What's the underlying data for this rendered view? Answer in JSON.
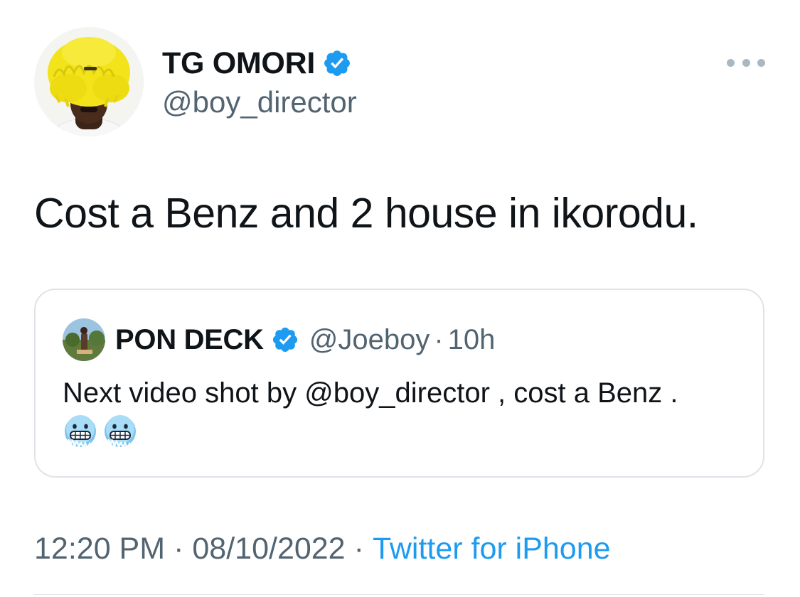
{
  "tweet": {
    "author": {
      "display_name": "TG OMORI",
      "handle": "@boy_director",
      "verified_icon": "verified-badge-icon"
    },
    "more_icon": "more-horizontal-icon",
    "text": "Cost a Benz and 2 house in ikorodu.",
    "quoted_tweet": {
      "display_name": "PON DECK",
      "handle": "@Joeboy",
      "separator": "·",
      "time": "10h",
      "text_before_emoji": "Next video shot by @boy_director , cost a Benz . ",
      "emojis": [
        "cold-face-emoji",
        "cold-face-emoji"
      ]
    },
    "meta": {
      "time": "12:20 PM",
      "dot": "·",
      "date": "08/10/2022",
      "source": "Twitter for iPhone"
    }
  },
  "colors": {
    "text_primary": "#0f1419",
    "text_secondary": "#536471",
    "link_blue": "#1d9bf0",
    "verified_blue": "#1d9bf0",
    "border": "#dfe3e7",
    "avatar_hair_yellow": "#f3e31b"
  }
}
